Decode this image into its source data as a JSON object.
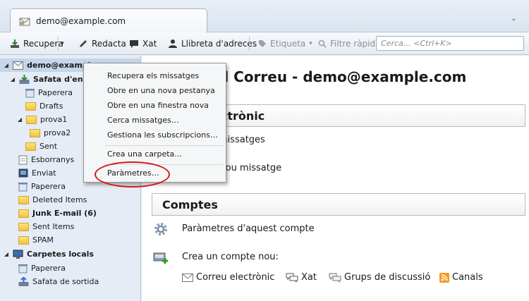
{
  "tab": {
    "title": "demo@example.com",
    "menu_glyph": "⌄"
  },
  "toolbar": {
    "get_messages": "Recupera",
    "write": "Redacta",
    "chat": "Xat",
    "address_book": "Llibreta d'adreces",
    "tag": "Etiqueta",
    "quick_filter": "Filtre ràpid",
    "search_placeholder": "Cerca… <Ctrl+K>"
  },
  "folders": {
    "account": "demo@example.com",
    "inbox": "Safata d'entrada",
    "trash_sub": "Paperera",
    "drafts_sub": "Drafts",
    "prova1": "prova1",
    "prova2": "prova2",
    "sent_sub": "Sent",
    "drafts": "Esborranys",
    "sent": "Enviat",
    "trash": "Paperera",
    "deleted_items": "Deleted Items",
    "junk": "Junk E-mail (6)",
    "sent_items": "Sent Items",
    "spam": "SPAM",
    "local_folders": "Carpetes locals",
    "local_trash": "Paperera",
    "outbox": "Safata de sortida"
  },
  "content": {
    "heading": "rd Correu - demo@example.com",
    "email_section": "ectrònic",
    "read_messages": "s missatges",
    "new_message": "n nou missatge",
    "accounts_section": "Comptes",
    "account_settings": "Paràmetres d'aquest compte",
    "create_account": "Crea un compte nou:",
    "opt_email": "Correu electrònic",
    "opt_chat": "Xat",
    "opt_newsgroups": "Grups de discussió",
    "opt_feeds": "Canals"
  },
  "context_menu": {
    "get_messages": "Recupera els missatges",
    "open_new_tab": "Obre en una nova pestanya",
    "open_new_window": "Obre en una finestra nova",
    "search_messages": "Cerca missatges…",
    "subscribe": "Gestiona les subscripcions…",
    "new_folder": "Crea una carpeta…",
    "settings": "Paràmetres…"
  },
  "colors": {
    "highlight_ellipse": "#d2191d",
    "folder": "#f0c43e",
    "selection": "#c5d5ea"
  }
}
